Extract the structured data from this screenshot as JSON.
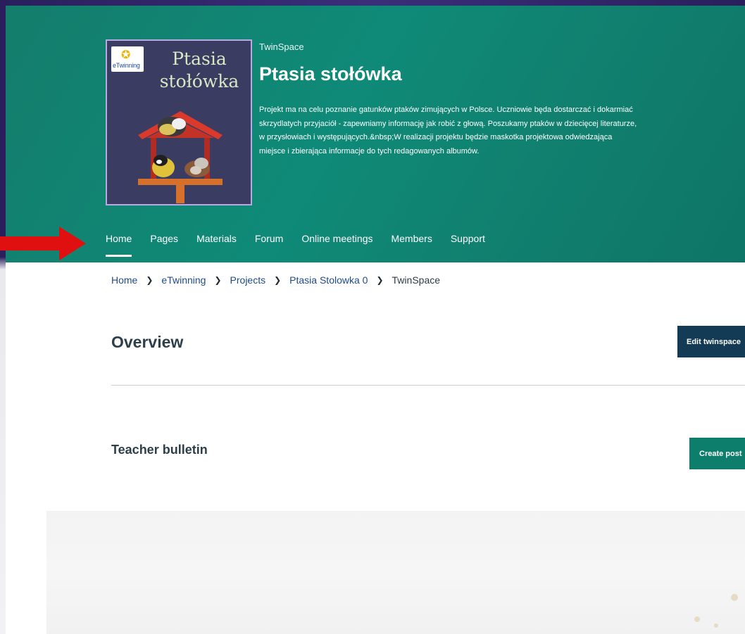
{
  "header": {
    "kicker": "TwinSpace",
    "title": "Ptasia stołówka",
    "description": "Projekt ma na celu poznanie gatunków ptaków zimujących w Polsce. Uczniowie będa dostarczać i dokarmiać skrzydlatych przyjaciół - zapewniamy informację jak robić z głową. Poszukamy ptaków w dziecięcej literaturze, w przysłowiach i występujących.&nbsp;W realizacji projektu będzie maskotka projektowa odwiedzająca miejsce i zbierająca informacje do tych redagowanych albumów.",
    "cover": {
      "logo_text": "eTwinning",
      "title_line1": "Ptasia",
      "title_line2": "stołówka"
    }
  },
  "nav": {
    "items": [
      {
        "label": "Home",
        "active": true
      },
      {
        "label": "Pages",
        "active": false
      },
      {
        "label": "Materials",
        "active": false
      },
      {
        "label": "Forum",
        "active": false
      },
      {
        "label": "Online meetings",
        "active": false
      },
      {
        "label": "Members",
        "active": false
      },
      {
        "label": "Support",
        "active": false
      }
    ]
  },
  "breadcrumb": {
    "items": [
      "Home",
      "eTwinning",
      "Projects",
      "Ptasia Stolowka 0"
    ],
    "current": "TwinSpace"
  },
  "overview": {
    "heading": "Overview",
    "edit_label": "Edit twinspace"
  },
  "bulletin": {
    "heading": "Teacher bulletin",
    "create_label": "Create post"
  },
  "colors": {
    "header_bg": "#11806f",
    "edit_button": "#133b55",
    "create_button": "#0d7e6b",
    "annotation_arrow": "#e01010"
  },
  "icons": {
    "breadcrumb_separator": "chevron-right-icon",
    "annotation": "red-arrow-icon"
  }
}
